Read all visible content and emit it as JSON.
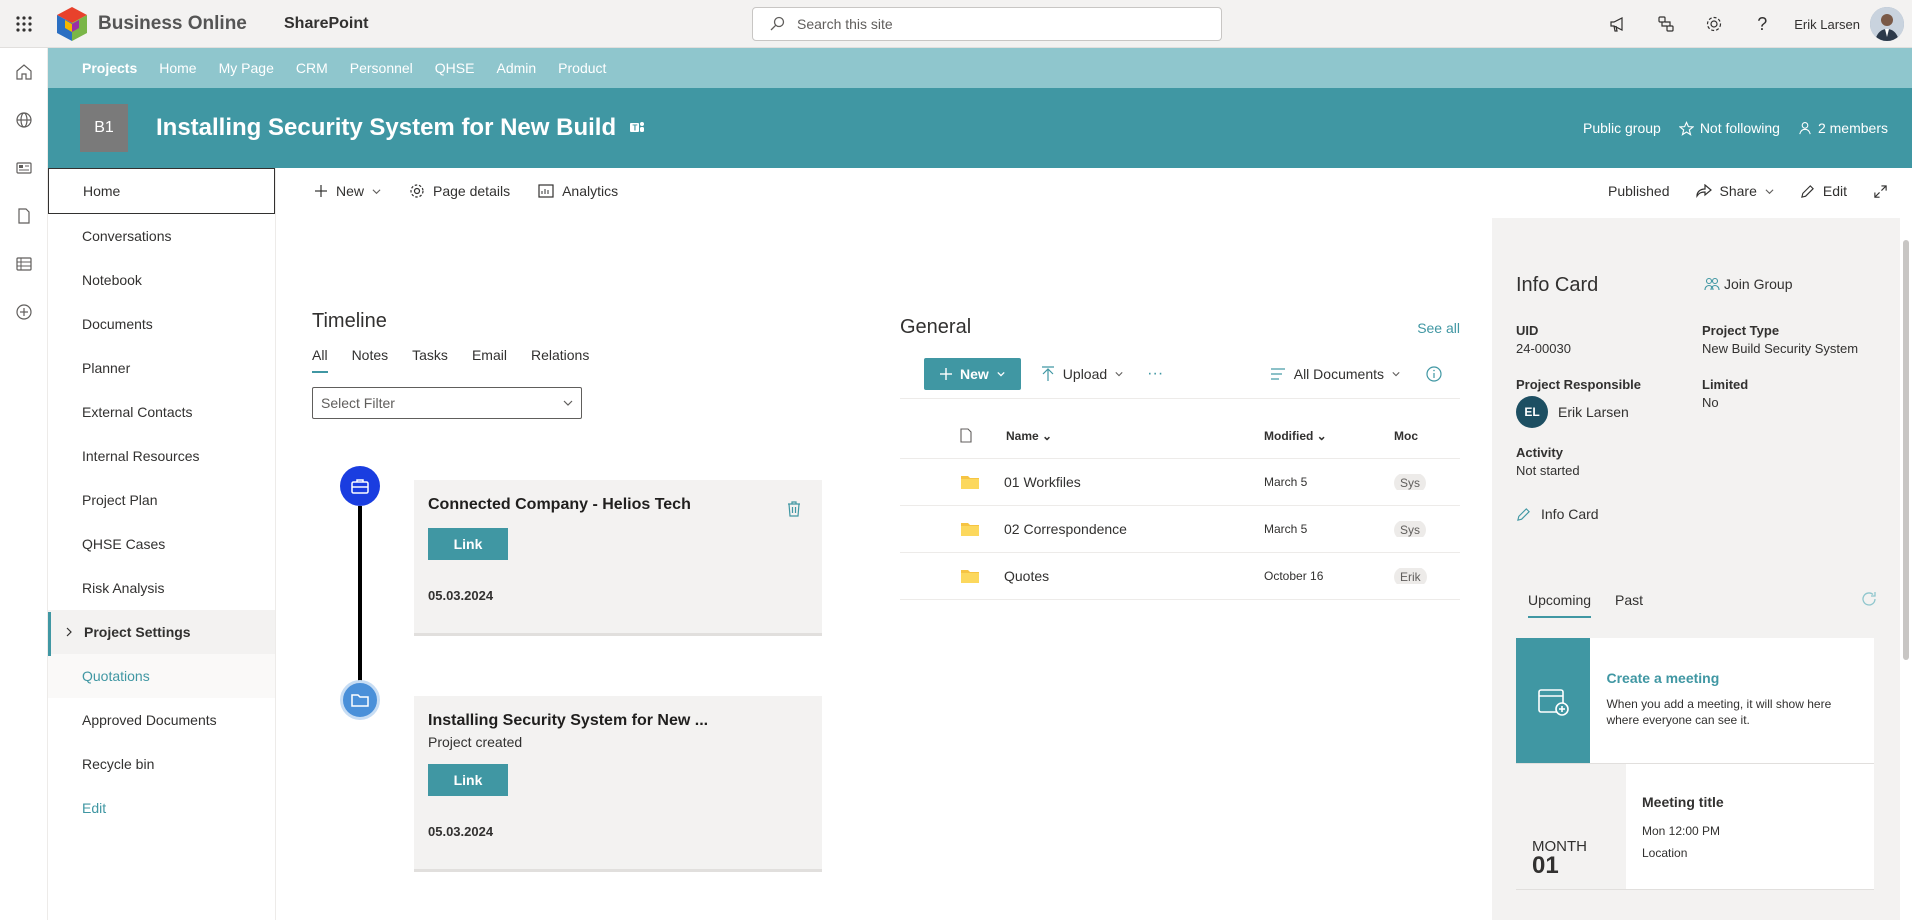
{
  "topbar": {
    "brand": "Business Online",
    "app": "SharePoint",
    "search_placeholder": "Search this site",
    "user_name": "Erik Larsen"
  },
  "hubnav": [
    "Projects",
    "Home",
    "My Page",
    "CRM",
    "Personnel",
    "QHSE",
    "Admin",
    "Product"
  ],
  "site": {
    "logo_text": "B1",
    "title": "Installing Security System for New Build",
    "privacy": "Public group",
    "follow": "Not following",
    "members": "2 members"
  },
  "quicklaunch": {
    "items": [
      "Home",
      "Conversations",
      "Notebook",
      "Documents",
      "Planner",
      "External Contacts",
      "Internal Resources",
      "Project Plan",
      "QHSE Cases",
      "Risk Analysis"
    ],
    "settings": "Project Settings",
    "sub": "Quotations",
    "more": [
      "Approved Documents",
      "Recycle bin"
    ],
    "edit": "Edit"
  },
  "commandbar": {
    "new": "New",
    "page_details": "Page details",
    "analytics": "Analytics",
    "published": "Published",
    "share": "Share",
    "edit": "Edit"
  },
  "timeline": {
    "title": "Timeline",
    "tabs": [
      "All",
      "Notes",
      "Tasks",
      "Email",
      "Relations"
    ],
    "filter_placeholder": "Select Filter",
    "cards": [
      {
        "title": "Connected Company - Helios Tech",
        "subtitle": "",
        "link": "Link",
        "date": "05.03.2024"
      },
      {
        "title": "Installing Security System for New ...",
        "subtitle": "Project created",
        "link": "Link",
        "date": "05.03.2024"
      }
    ]
  },
  "general": {
    "title": "General",
    "see_all": "See all",
    "new": "New",
    "upload": "Upload",
    "more": "···",
    "view": "All Documents",
    "columns": {
      "name": "Name",
      "modified": "Modified",
      "modified_by": "Moc"
    },
    "rows": [
      {
        "name": "01 Workfiles",
        "modified": "March 5",
        "by": "Sys"
      },
      {
        "name": "02 Correspondence",
        "modified": "March 5",
        "by": "Sys"
      },
      {
        "name": "Quotes",
        "modified": "October 16",
        "by": "Erik"
      }
    ]
  },
  "infocard": {
    "title": "Info Card",
    "join": "Join Group",
    "uid_label": "UID",
    "uid": "24-00030",
    "type_label": "Project Type",
    "type": "New Build Security System",
    "resp_label": "Project Responsible",
    "resp_initials": "EL",
    "resp": "Erik Larsen",
    "limited_label": "Limited",
    "limited": "No",
    "activity_label": "Activity",
    "activity": "Not started",
    "edit_label": "Info Card"
  },
  "events": {
    "tabs": [
      "Upcoming",
      "Past"
    ],
    "create_title": "Create a meeting",
    "create_desc": "When you add a meeting, it will show here where everyone can see it.",
    "meeting_title": "Meeting title",
    "meeting_time": "Mon 12:00 PM",
    "meeting_location": "Location",
    "month": "MONTH",
    "day": "01"
  }
}
